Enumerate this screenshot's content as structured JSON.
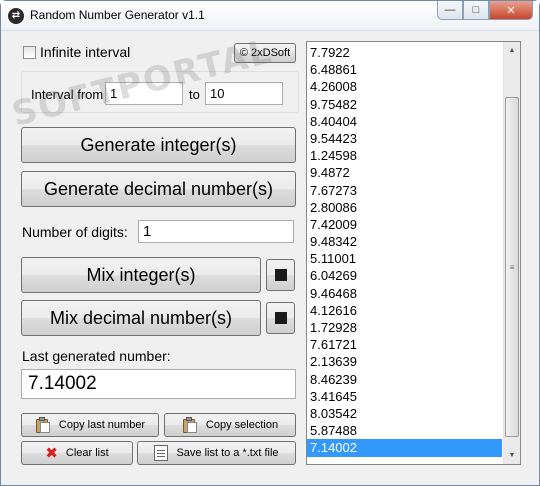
{
  "window": {
    "title": "Random Number Generator v1.1",
    "controls": {
      "minimize": "—",
      "maximize": "□",
      "close": "✕"
    }
  },
  "settings": {
    "infinite_interval_label": "Infinite interval",
    "infinite_interval_checked": false,
    "about_button": "© 2xDSoft",
    "interval_from_label": "Interval from",
    "interval_from_value": "1",
    "interval_to_label": "to",
    "interval_to_value": "10"
  },
  "actions": {
    "generate_integers": "Generate integer(s)",
    "generate_decimals": "Generate decimal number(s)",
    "digits_label": "Number of digits:",
    "digits_value": "1",
    "mix_integers": "Mix integer(s)",
    "mix_decimals": "Mix decimal number(s)"
  },
  "result": {
    "last_label": "Last generated number:",
    "last_value": "7.14002"
  },
  "bottom_buttons": {
    "copy_last": "Copy last number",
    "copy_selection": "Copy selection",
    "clear_list": "Clear list",
    "save_list": "Save list to a *.txt file"
  },
  "numbers": [
    "7.7922",
    "6.48861",
    "4.26008",
    "9.75482",
    "8.40404",
    "9.54423",
    "1.24598",
    "9.4872",
    "7.67273",
    "2.80086",
    "7.42009",
    "9.48342",
    "5.11001",
    "6.04269",
    "9.46468",
    "4.12616",
    "1.72928",
    "7.61721",
    "2.13639",
    "8.46239",
    "3.41645",
    "8.03542",
    "5.87488",
    "7.14002"
  ],
  "selected_index": 23,
  "watermark": "SOFTPORTAL",
  "colors": {
    "selection": "#3399ff",
    "close_button": "#c7452b"
  }
}
